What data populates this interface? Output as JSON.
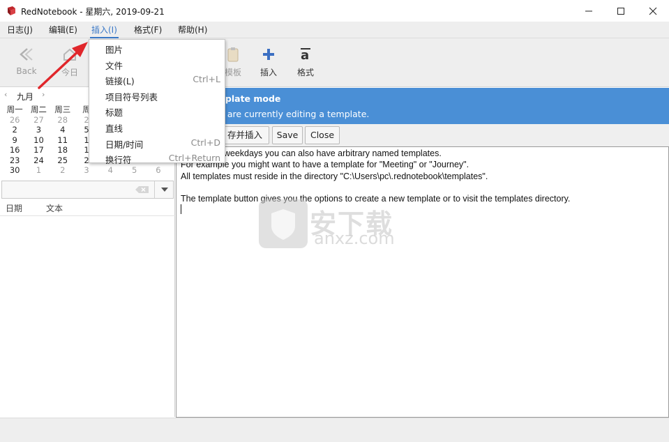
{
  "window": {
    "title": "RedNotebook - 星期六, 2019-09-21",
    "minimize_icon": "minimize-icon",
    "maximize_icon": "maximize-icon",
    "close_icon": "close-icon"
  },
  "menubar": {
    "items": [
      {
        "label": "日志(J)"
      },
      {
        "label": "编辑(E)"
      },
      {
        "label": "插入(I)"
      },
      {
        "label": "格式(F)"
      },
      {
        "label": "帮助(H)"
      }
    ]
  },
  "toolbar": {
    "back_label": "Back",
    "today_label": "今日",
    "template_label": "模板",
    "insert_label": "插入",
    "format_label": "格式"
  },
  "insert_menu": {
    "items": [
      {
        "label": "图片",
        "accel": ""
      },
      {
        "label": "文件",
        "accel": ""
      },
      {
        "label": "链接(L)",
        "accel": "Ctrl+L"
      },
      {
        "label": "项目符号列表",
        "accel": ""
      },
      {
        "label": "标题",
        "accel": ""
      },
      {
        "label": "直线",
        "accel": ""
      },
      {
        "label": "日期/时间",
        "accel": "Ctrl+D"
      },
      {
        "label": "换行符",
        "accel": "Ctrl+Return"
      }
    ]
  },
  "calendar": {
    "month": "九月",
    "weekdays": [
      "周一",
      "周二",
      "周三",
      "周",
      "",
      "",
      ""
    ],
    "weeks": [
      [
        {
          "d": "26",
          "o": true
        },
        {
          "d": "27",
          "o": true
        },
        {
          "d": "28",
          "o": true
        },
        {
          "d": "2",
          "o": true
        },
        {
          "d": "",
          "o": false
        },
        {
          "d": "",
          "o": false
        },
        {
          "d": "",
          "o": false
        }
      ],
      [
        {
          "d": "2",
          "o": false
        },
        {
          "d": "3",
          "o": false
        },
        {
          "d": "4",
          "o": false
        },
        {
          "d": "5",
          "o": false
        },
        {
          "d": "",
          "o": false
        },
        {
          "d": "",
          "o": false
        },
        {
          "d": "",
          "o": false
        }
      ],
      [
        {
          "d": "9",
          "o": false
        },
        {
          "d": "10",
          "o": false
        },
        {
          "d": "11",
          "o": false
        },
        {
          "d": "1",
          "o": false
        },
        {
          "d": "",
          "o": false
        },
        {
          "d": "",
          "o": false
        },
        {
          "d": "",
          "o": false
        }
      ],
      [
        {
          "d": "16",
          "o": false
        },
        {
          "d": "17",
          "o": false
        },
        {
          "d": "18",
          "o": false
        },
        {
          "d": "1",
          "o": false
        },
        {
          "d": "",
          "o": false
        },
        {
          "d": "",
          "o": false
        },
        {
          "d": "",
          "o": false
        }
      ],
      [
        {
          "d": "23",
          "o": false
        },
        {
          "d": "24",
          "o": false
        },
        {
          "d": "25",
          "o": false
        },
        {
          "d": "2",
          "o": false
        },
        {
          "d": "",
          "o": false
        },
        {
          "d": "",
          "o": false
        },
        {
          "d": "",
          "o": false
        }
      ],
      [
        {
          "d": "30",
          "o": false
        },
        {
          "d": "1",
          "o": true
        },
        {
          "d": "2",
          "o": true
        },
        {
          "d": "3",
          "o": true
        },
        {
          "d": "4",
          "o": true
        },
        {
          "d": "5",
          "o": true
        },
        {
          "d": "6",
          "o": true
        }
      ]
    ]
  },
  "search": {
    "value": "",
    "placeholder": ""
  },
  "list": {
    "col_date": "日期",
    "col_text": "文本"
  },
  "banner": {
    "title": "nplate mode",
    "subtitle": "u are currently editing a template."
  },
  "buttons": {
    "save_insert": "存并插入",
    "save": "Save",
    "close": "Close"
  },
  "editor": {
    "lines": [
      "nplates for weekdays you can also have arbitrary named templates.",
      "For example you might want to have a template for \"Meeting\" or \"Journey\".",
      "All templates must reside in the directory \"C:\\Users\\pc\\.rednotebook\\templates\".",
      "",
      "The template button gives you the options to create a new template or to visit the templates directory."
    ]
  },
  "watermark": {
    "text": "安下载",
    "domain": "anxz.com"
  },
  "colors": {
    "accent": "#3a78c7",
    "banner": "#4a8fd6",
    "arrow": "#e0262b"
  }
}
